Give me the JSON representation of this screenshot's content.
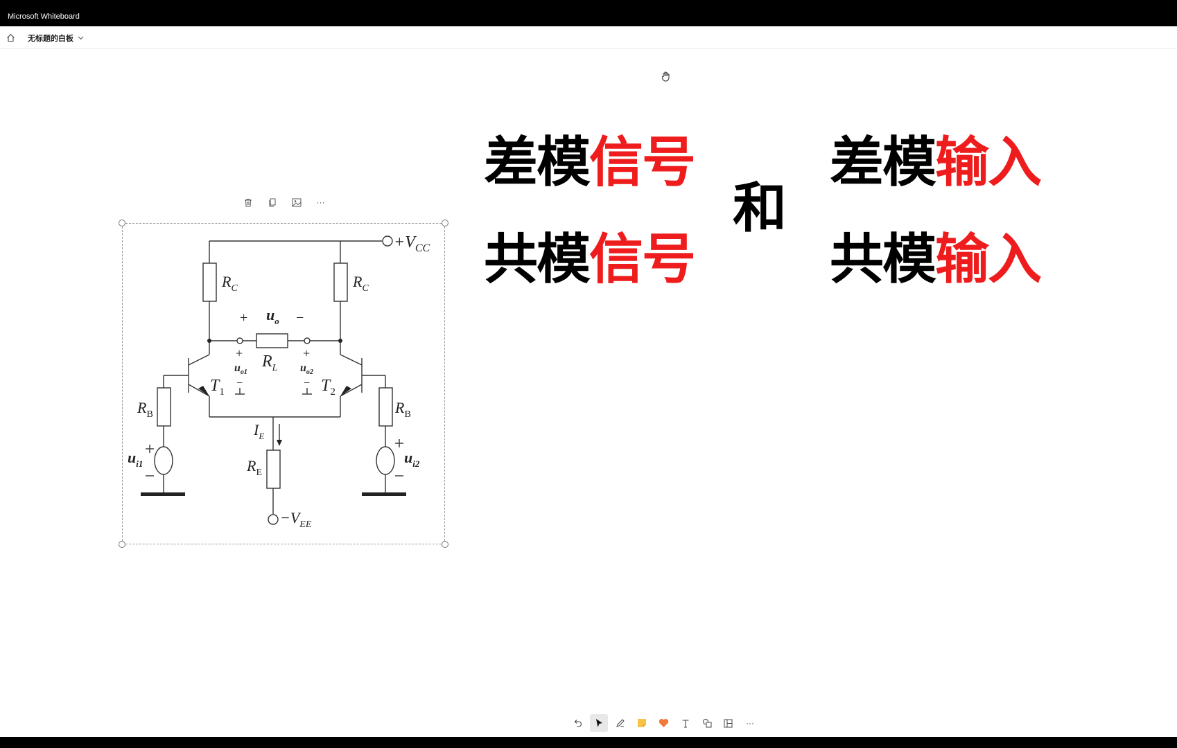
{
  "window": {
    "title": "Microsoft Whiteboard"
  },
  "appbar": {
    "board_name": "无标题的白板"
  },
  "canvas": {
    "row1_left_black": "差模",
    "row1_left_red": "信号",
    "row2_left_black": "共模",
    "row2_left_red": "信号",
    "middle": "和",
    "row1_right_black": "差模",
    "row1_right_red": "输入",
    "row2_right_black": "共模",
    "row2_right_red": "输入"
  },
  "circuit": {
    "vcc": "+V",
    "vcc_sub": "CC",
    "rc": "R",
    "rc_sub": "C",
    "rl": "R",
    "rl_sub": "L",
    "uo": "u",
    "uo_sub": "o",
    "uo1": "u",
    "uo1_sub": "o1",
    "uo2": "u",
    "uo2_sub": "o2",
    "t1": "T",
    "t1_sub": "1",
    "t2": "T",
    "t2_sub": "2",
    "rb": "R",
    "rb_sub": "B",
    "ie": "I",
    "ie_sub": "E",
    "re": "R",
    "re_sub": "E",
    "ui1": "u",
    "ui1_sub": "i1",
    "ui2": "u",
    "ui2_sub": "i2",
    "vee": "−V",
    "vee_sub": "EE",
    "plus": "+",
    "minus": "−"
  },
  "context_toolbar": {
    "more": "···"
  },
  "bottom_toolbar": {
    "more": "···"
  },
  "colors": {
    "accent_red": "#ee1c1c",
    "sticky_yellow": "#f6c343",
    "reaction_orange": "#f07a3a"
  }
}
